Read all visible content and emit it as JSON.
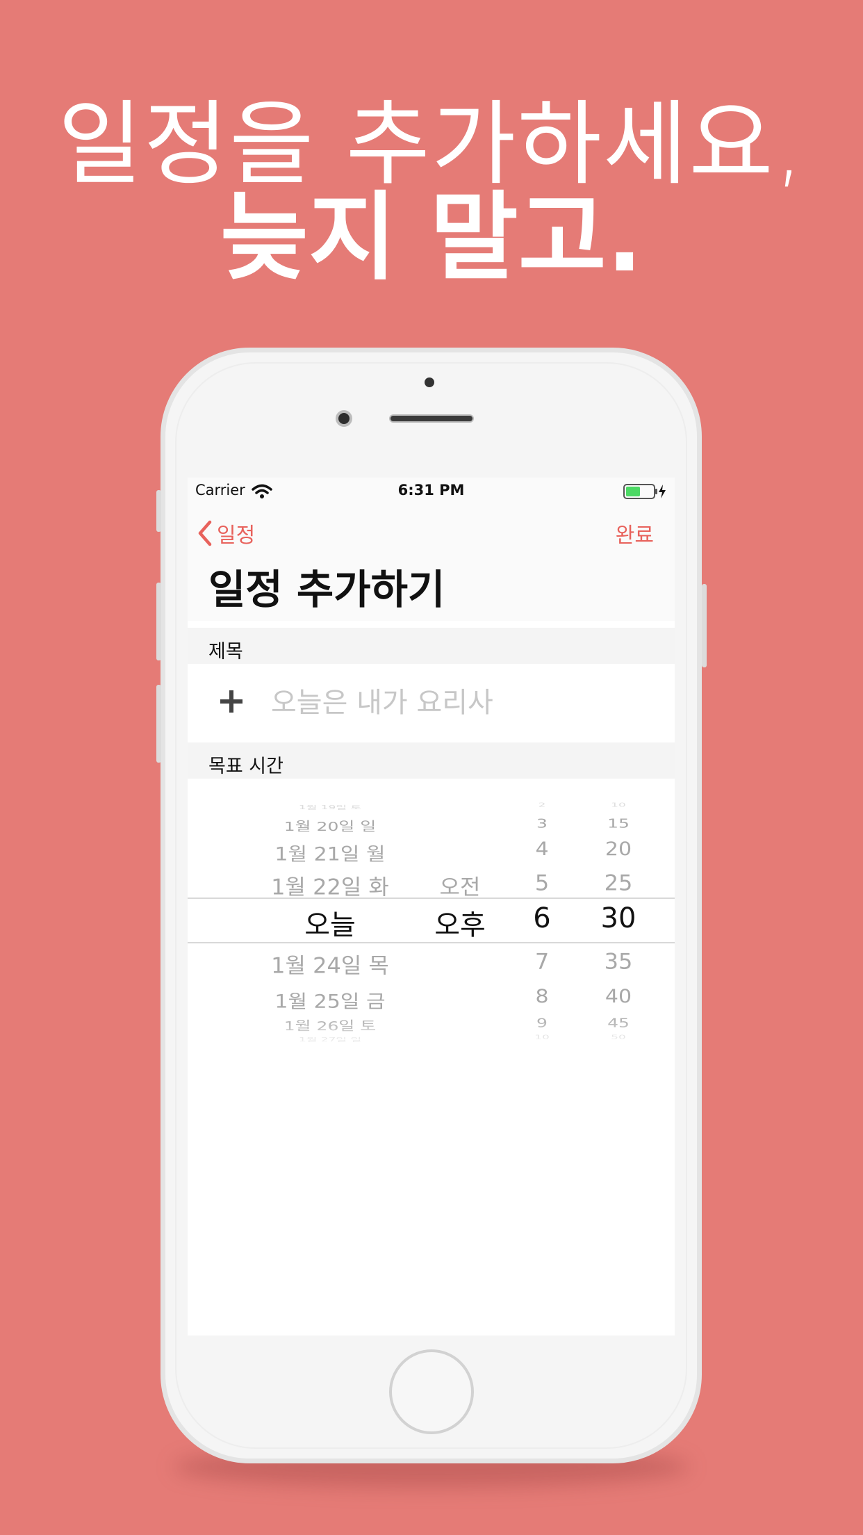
{
  "headline": {
    "line1": "일정을 추가하세요,",
    "line2": "늦지 말고."
  },
  "status_bar": {
    "carrier": "Carrier",
    "time": "6:31 PM"
  },
  "nav": {
    "back_label": "일정",
    "done_label": "완료"
  },
  "page": {
    "title": "일정 추가하기"
  },
  "sections": {
    "title_header": "제목",
    "time_header": "목표 시간"
  },
  "title_field": {
    "value": "",
    "placeholder": "오늘은 내가 요리사"
  },
  "picker": {
    "dates": [
      "1월 19일 토",
      "1월 20일 일",
      "1월 21일 월",
      "1월 22일 화",
      "오늘",
      "1월 24일 목",
      "1월 25일 금",
      "1월 26일 토",
      "1월 27일 일"
    ],
    "ampm": [
      "오전",
      "오후"
    ],
    "hours": [
      "2",
      "3",
      "4",
      "5",
      "6",
      "7",
      "8",
      "9",
      "10"
    ],
    "minutes": [
      "10",
      "15",
      "20",
      "25",
      "30",
      "35",
      "40",
      "45",
      "50"
    ],
    "selected": {
      "date": "오늘",
      "ampm": "오후",
      "hour": "6",
      "minute": "30"
    }
  },
  "colors": {
    "background": "#e57b76",
    "accent": "#e8625c",
    "battery": "#4cd964"
  },
  "icons": {
    "back": "chevron-left-icon",
    "add": "plus-icon",
    "wifi": "wifi-icon",
    "battery": "battery-icon"
  }
}
